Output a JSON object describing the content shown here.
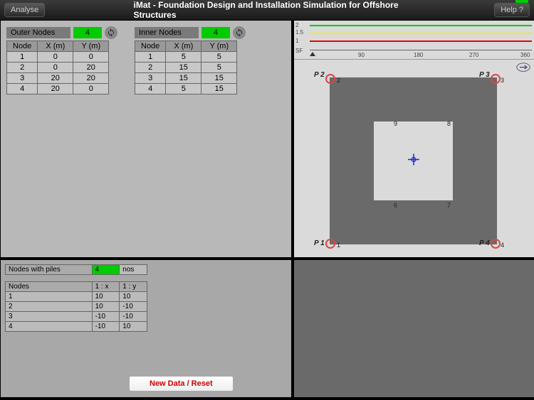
{
  "topbar": {
    "analyse": "Analyse",
    "title": "iMat - Foundation Design and Installation Simulation for Offshore Structures",
    "help": "Help ?"
  },
  "outer": {
    "label": "Outer Nodes",
    "count": "4",
    "headers": {
      "node": "Node",
      "x": "X (m)",
      "y": "Y (m)"
    },
    "rows": [
      {
        "n": "1",
        "x": "0",
        "y": "0"
      },
      {
        "n": "2",
        "x": "0",
        "y": "20"
      },
      {
        "n": "3",
        "x": "20",
        "y": "20"
      },
      {
        "n": "4",
        "x": "20",
        "y": "0"
      }
    ]
  },
  "inner": {
    "label": "Inner Nodes",
    "count": "4",
    "headers": {
      "node": "Node",
      "x": "X (m)",
      "y": "Y (m)"
    },
    "rows": [
      {
        "n": "1",
        "x": "5",
        "y": "5"
      },
      {
        "n": "2",
        "x": "15",
        "y": "5"
      },
      {
        "n": "3",
        "x": "15",
        "y": "15"
      },
      {
        "n": "4",
        "x": "5",
        "y": "15"
      }
    ]
  },
  "chart_data": {
    "type": "line",
    "title": "",
    "xlabel": "",
    "ylabel": "",
    "x_ticks": [
      "90",
      "180",
      "270",
      "360"
    ],
    "y_ticks": [
      "SF",
      "1",
      "1.5",
      "2"
    ],
    "xlim": [
      0,
      360
    ],
    "series": [
      {
        "name": "green",
        "color": "#0c0",
        "y": 2
      },
      {
        "name": "yellow",
        "color": "#ee0",
        "y": 1.5
      },
      {
        "name": "red",
        "color": "#e00",
        "y": 1
      }
    ]
  },
  "diagram": {
    "piles": [
      {
        "label": "P 1",
        "pos": "bl"
      },
      {
        "label": "P 2",
        "pos": "tl"
      },
      {
        "label": "P 3",
        "pos": "tr"
      },
      {
        "label": "P 4",
        "pos": "br"
      }
    ],
    "outer_nodes": {
      "tl": "2",
      "tr": "3",
      "bl": "1",
      "br": "4"
    },
    "inner_nodes": {
      "tl": "9",
      "tr": "8",
      "bl": "6",
      "br": "7"
    }
  },
  "piles": {
    "header_label": "Nodes with piles",
    "header_count": "4",
    "header_unit": "nos",
    "col_label": "Nodes",
    "col1": "1 : x",
    "col2": "1 : y",
    "rows": [
      {
        "n": "1",
        "x": "10",
        "y": "10"
      },
      {
        "n": "2",
        "x": "10",
        "y": "-10"
      },
      {
        "n": "3",
        "x": "-10",
        "y": "-10"
      },
      {
        "n": "4",
        "x": "-10",
        "y": "10"
      }
    ]
  },
  "reset_label": "New Data / Reset"
}
